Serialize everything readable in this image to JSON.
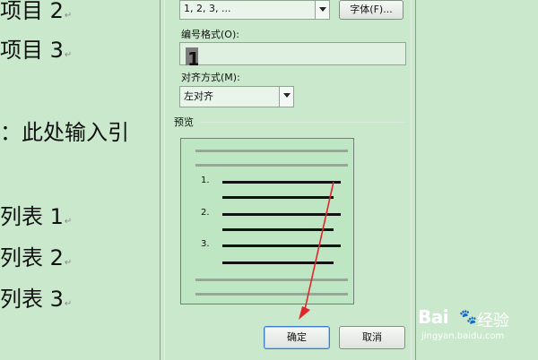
{
  "document": {
    "lines": [
      {
        "text": "项目 2",
        "mark": "↵"
      },
      {
        "text": "项目 3",
        "mark": "↵"
      },
      {
        "text": "：此处输入引",
        "mark": ""
      },
      {
        "text": "列表 1",
        "mark": "↵"
      },
      {
        "text": "列表 2",
        "mark": "↵"
      },
      {
        "text": "列表 3",
        "mark": "↵"
      }
    ]
  },
  "dialog": {
    "number_style_value": "1, 2, 3, ...",
    "font_button_label": "字体(F)...",
    "number_format_label": "编号格式(O):",
    "number_format_value": "1",
    "alignment_label": "对齐方式(M):",
    "alignment_value": "左对齐",
    "preview_label": "预览",
    "preview_numbers": [
      "1.",
      "2.",
      "3."
    ],
    "ok_label": "确定",
    "cancel_label": "取消"
  },
  "watermark": {
    "brand": "Bai",
    "brand_cn": "经验",
    "url": "jingyan.baidu.com"
  },
  "colors": {
    "background": "#c9e8cc",
    "annotation_arrow": "#e0262a"
  }
}
